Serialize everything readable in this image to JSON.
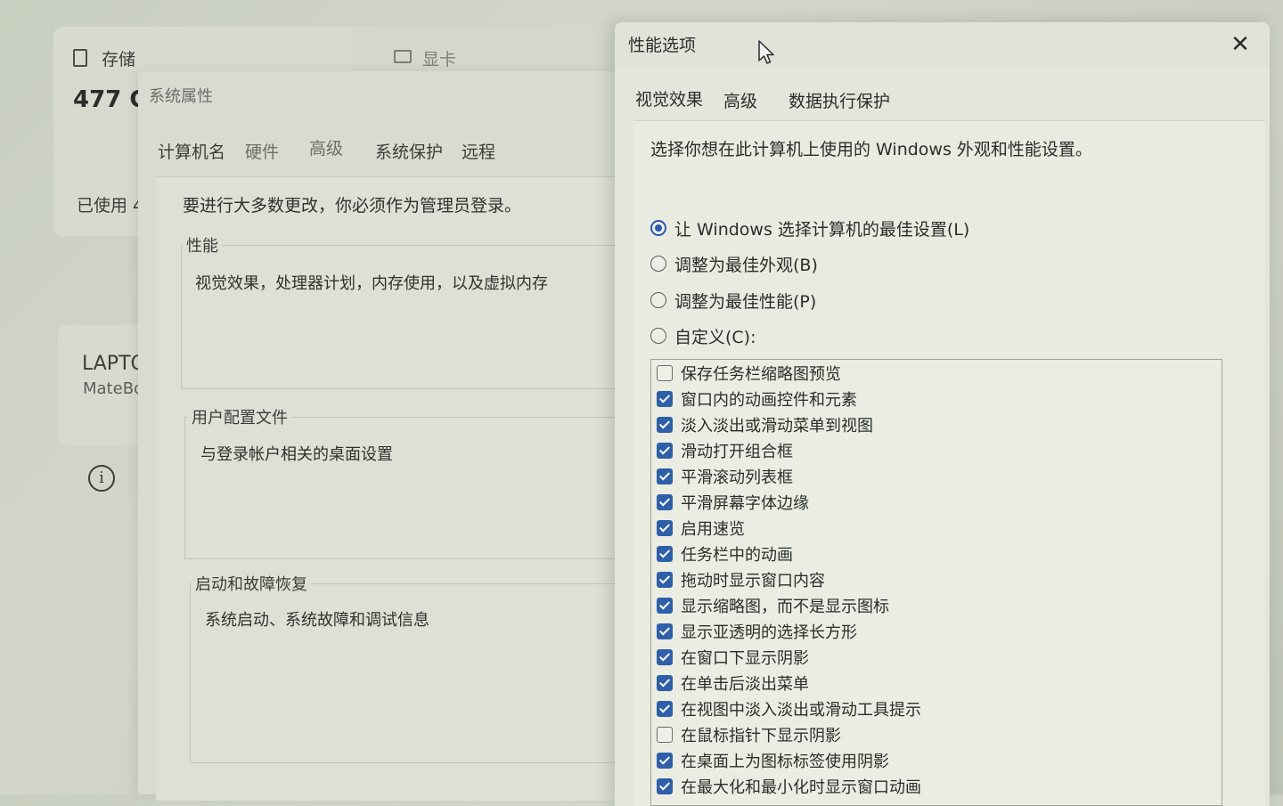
{
  "background": {
    "storage_label": "存储",
    "gpu_label": "显卡",
    "storage_value": "477 G",
    "used_label": "已使用 4",
    "device_name": "LAPTO",
    "device_model": "MateBo"
  },
  "system_properties": {
    "title": "系统属性",
    "tabs": [
      "计算机名",
      "硬件",
      "高级",
      "系统保护",
      "远程"
    ],
    "admin_message": "要进行大多数更改，你必须作为管理员登录。",
    "performance": {
      "title": "性能",
      "description": "视觉效果，处理器计划，内存使用，以及虚拟内存"
    },
    "user_profiles": {
      "title": "用户配置文件",
      "description": "与登录帐户相关的桌面设置"
    },
    "startup_recovery": {
      "title": "启动和故障恢复",
      "description": "系统启动、系统故障和调试信息"
    }
  },
  "performance_options": {
    "title": "性能选项",
    "close_label": "✕",
    "tabs": [
      "视觉效果",
      "高级",
      "数据执行保护"
    ],
    "intro": "选择你想在此计算机上使用的 Windows 外观和性能设置。",
    "radios": [
      {
        "label": "让 Windows 选择计算机的最佳设置(L)",
        "checked": true
      },
      {
        "label": "调整为最佳外观(B)",
        "checked": false
      },
      {
        "label": "调整为最佳性能(P)",
        "checked": false
      },
      {
        "label": "自定义(C):",
        "checked": false
      }
    ],
    "checkboxes": [
      {
        "label": "保存任务栏缩略图预览",
        "checked": false
      },
      {
        "label": "窗口内的动画控件和元素",
        "checked": true
      },
      {
        "label": "淡入淡出或滑动菜单到视图",
        "checked": true
      },
      {
        "label": "滑动打开组合框",
        "checked": true
      },
      {
        "label": "平滑滚动列表框",
        "checked": true
      },
      {
        "label": "平滑屏幕字体边缘",
        "checked": true
      },
      {
        "label": "启用速览",
        "checked": true
      },
      {
        "label": "任务栏中的动画",
        "checked": true
      },
      {
        "label": "拖动时显示窗口内容",
        "checked": true
      },
      {
        "label": "显示缩略图，而不是显示图标",
        "checked": true
      },
      {
        "label": "显示亚透明的选择长方形",
        "checked": true
      },
      {
        "label": "在窗口下显示阴影",
        "checked": true
      },
      {
        "label": "在单击后淡出菜单",
        "checked": true
      },
      {
        "label": "在视图中淡入淡出或滑动工具提示",
        "checked": true
      },
      {
        "label": "在鼠标指针下显示阴影",
        "checked": false
      },
      {
        "label": "在桌面上为图标标签使用阴影",
        "checked": true
      },
      {
        "label": "在最大化和最小化时显示窗口动画",
        "checked": true
      }
    ]
  }
}
